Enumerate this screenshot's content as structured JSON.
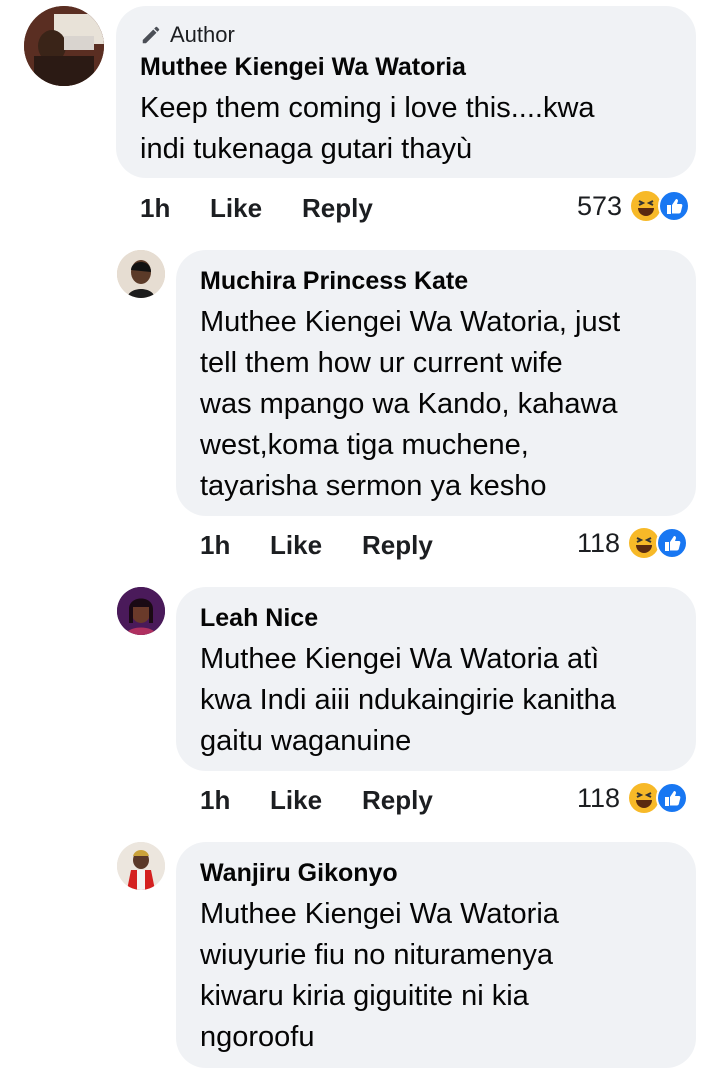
{
  "comments": [
    {
      "badge": "Author",
      "name": "Muthee Kiengei Wa Watoria",
      "lines": [
        "Keep them coming i love this....kwa",
        "indi tukenaga gutari thayù"
      ],
      "time": "1h",
      "like": "Like",
      "reply": "Reply",
      "count": "573"
    },
    {
      "name": "Muchira Princess Kate",
      "lines": [
        "Muthee Kiengei Wa Watoria, just",
        "tell them how ur current wife",
        "was mpango wa Kando, kahawa",
        "west,koma tiga muchene,",
        "tayarisha sermon ya kesho"
      ],
      "time": "1h",
      "like": "Like",
      "reply": "Reply",
      "count": "118"
    },
    {
      "name": "Leah Nice",
      "lines": [
        "Muthee Kiengei Wa Watoria atì",
        "kwa Indi aiii ndukaingirie kanitha",
        "gaitu waganuine"
      ],
      "time": "1h",
      "like": "Like",
      "reply": "Reply",
      "count": "118"
    },
    {
      "name": "Wanjiru Gikonyo",
      "lines": [
        "Muthee Kiengei Wa Watoria",
        "wiuyurie fiu no nituramenya",
        "kiwaru kiria giguitite ni kia",
        "ngoroofu"
      ]
    }
  ],
  "colors": {
    "bubble": "#f0f2f5",
    "like_blue": "#1877f2",
    "haha_yellow": "#f7b928"
  }
}
